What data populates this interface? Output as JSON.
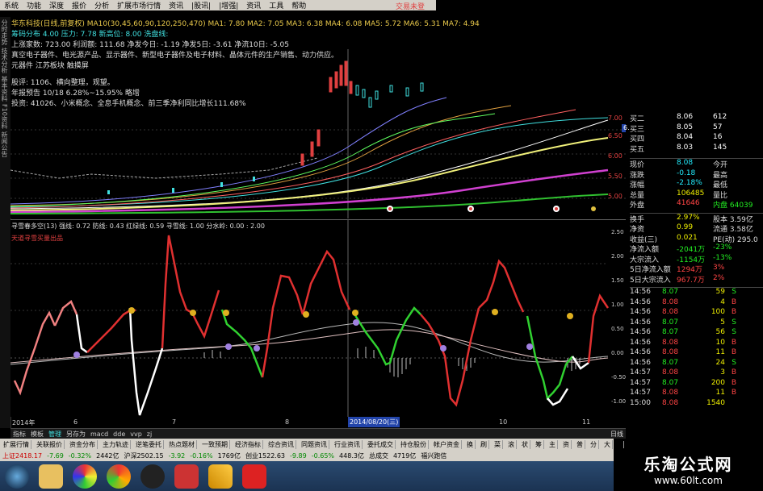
{
  "menu": [
    "系统",
    "功能",
    "深度",
    "报价",
    "分析",
    "扩展市场行情",
    "资讯",
    "|股讯|",
    "|增强|",
    "资讯",
    "工具",
    "帮助"
  ],
  "brand": "交易未登",
  "left_strip": [
    "分时走势",
    "技术分析",
    "基本资料",
    "F10资料",
    "新闻公告"
  ],
  "header_lines": [
    {
      "text": "华东科技(日线,前复权) MA10(30,45,60,90,120,250,470)  MA1: 7.80  MA2: 7.05  MA3: 6.38  MA4: 6.08  MA5: 5.72  MA6: 5.31  MA7: 4.94",
      "color": "#e8c84a"
    },
    {
      "text": "筹码分布  4.00  压力: 7.78  新高位: 8.00  洗盘线:",
      "color": "#40e0e0"
    },
    {
      "text": "上涨家数: 723.00  利润额: 111.68  净发今日: -1.19  净发5日: -3.61  净流10日: -5.05",
      "color": "#ddd"
    },
    {
      "text": "真空电子器件、电光源产品、显示器件、新型电子器件及电子材料、晶体元件的生产销售、动力供应。",
      "color": "#ddd"
    },
    {
      "text": "元器件  江苏板块  触摸屏",
      "color": "#ddd"
    },
    {
      "text": "股评: 1106、横向整理，观望。",
      "color": "#ddd"
    },
    {
      "text": "年报预告 10/18 6.28%~15.95% 略增",
      "color": "#ddd"
    },
    {
      "text": "投资: 41026、小米概念、全息手机概念、前三季净利同比增长111.68%",
      "color": "#ddd"
    }
  ],
  "price_axis": [
    "7.00",
    "6.50",
    "6.00",
    "5.50",
    "5.00"
  ],
  "current_price_tag": "6.61",
  "indicator_header": "寻雪春多空(13) 强线: 0.72  防线: 0.43  红绿线: 0.59  寻雪线: 1.00  分水岭: 0.00 : 2.00",
  "indicator_sub": "天道寻雪买量出品",
  "ind_axis": [
    "2.50",
    "2.00",
    "1.50",
    "1.00",
    "0.50",
    "0.00",
    "-0.50",
    "-1.00"
  ],
  "date_axis": [
    "2014年",
    "6",
    "7",
    "8",
    "2014/08/20(三)",
    "10",
    "11"
  ],
  "date_marker": "2014/08/20(三)",
  "right_panel": [
    {
      "label": "买二",
      "value": "8.06",
      "vol": "612",
      "c": "#fff"
    },
    {
      "label": "买三",
      "value": "8.05",
      "vol": "57",
      "c": "#fff"
    },
    {
      "label": "买四",
      "value": "8.04",
      "vol": "16",
      "c": "#fff"
    },
    {
      "label": "买五",
      "value": "8.03",
      "vol": "145",
      "c": "#fff"
    },
    {
      "label": "现价",
      "value": "8.08",
      "vol": "今开",
      "c": "#2ef"
    },
    {
      "label": "涨跌",
      "value": "-0.18",
      "vol": "最高",
      "c": "#2ef"
    },
    {
      "label": "涨幅",
      "value": "-2.18%",
      "vol": "最低",
      "c": "#2ef"
    },
    {
      "label": "总量",
      "value": "106485",
      "vol": "量比",
      "c": "#ee0"
    },
    {
      "label": "外盘",
      "value": "41646",
      "vol": "内盘 64039",
      "c": "#ee0"
    },
    {
      "label": "换手",
      "value": "2.97%",
      "vol": "股本 3.59亿",
      "c": "#ddd"
    },
    {
      "label": "净资",
      "value": "0.99",
      "vol": "流通 3.58亿",
      "c": "#ddd"
    },
    {
      "label": "收益(三)",
      "value": "0.021",
      "vol": "PE(动) 295.0",
      "c": "#ddd"
    },
    {
      "label": "净流入额",
      "value": "-2041万",
      "vol": "-23%",
      "c": "#2e2"
    },
    {
      "label": "大宗流入",
      "value": "-1154万",
      "vol": "-13%",
      "c": "#2e2"
    },
    {
      "label": "5日净流入额",
      "value": "1294万",
      "vol": "3%",
      "c": "#f44"
    },
    {
      "label": "5日大宗流入",
      "value": "967.7万",
      "vol": "2%",
      "c": "#f44"
    }
  ],
  "ticks": [
    {
      "t": "14:56",
      "p": "8.07",
      "v": "59",
      "d": "S"
    },
    {
      "t": "14:56",
      "p": "8.08",
      "v": "4",
      "d": "B"
    },
    {
      "t": "14:56",
      "p": "8.08",
      "v": "100",
      "d": "B"
    },
    {
      "t": "14:56",
      "p": "8.07",
      "v": "5",
      "d": "S"
    },
    {
      "t": "14:56",
      "p": "8.07",
      "v": "56",
      "d": "S"
    },
    {
      "t": "14:56",
      "p": "8.08",
      "v": "10",
      "d": "B"
    },
    {
      "t": "14:56",
      "p": "8.08",
      "v": "11",
      "d": "B"
    },
    {
      "t": "14:56",
      "p": "8.07",
      "v": "24",
      "d": "S"
    },
    {
      "t": "14:57",
      "p": "8.08",
      "v": "3",
      "d": "B"
    },
    {
      "t": "14:57",
      "p": "8.07",
      "v": "200",
      "d": "B"
    },
    {
      "t": "14:57",
      "p": "8.08",
      "v": "11",
      "d": "B"
    },
    {
      "t": "15:00",
      "p": "8.08",
      "v": "1540",
      "d": ""
    }
  ],
  "bottom_tabs": [
    "指标",
    "模板",
    "管理",
    "另存为",
    "macd",
    "dde",
    "vvp",
    "zj",
    "□",
    "(",
    "□",
    "□",
    "6",
    "7",
    "8",
    "9",
    "10",
    "11",
    "日线"
  ],
  "funcbar": [
    "扩展行情",
    "关联报价",
    "资金分布",
    "主力轨迹",
    "逆笔委托",
    "热点题材",
    "一致预期",
    "经济指标",
    "综合资讯",
    "同题资讯",
    "行业资讯",
    "委托成交",
    "持仓股份",
    "帐户资金",
    "换",
    "刷",
    "菜",
    "滚",
    "状",
    "筹",
    "主",
    "资",
    "普",
    "分",
    "大",
    "F"
  ],
  "statusbar": [
    "上证2418.17",
    "-7.69",
    "-0.32%",
    "2442亿",
    "沪深2502.15",
    "-3.92",
    "-0.16%",
    "1769亿",
    "创业1522.63",
    "-9.89",
    "-0.65%",
    "448.3亿",
    "总成交",
    "4719亿",
    "福兴跑信"
  ],
  "watermark_title": "乐淘公式网",
  "watermark_url": "www.60lt.com"
}
